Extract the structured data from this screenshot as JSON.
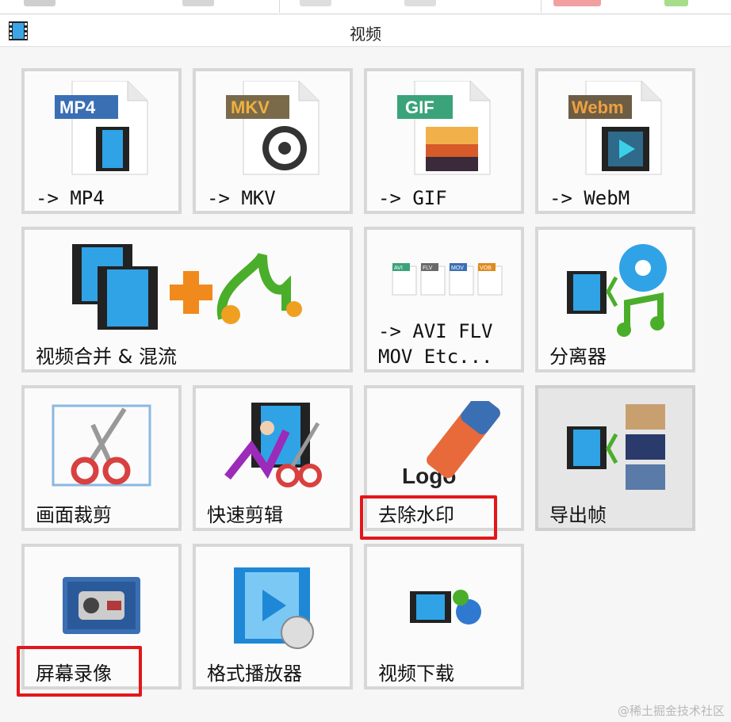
{
  "window": {
    "title": "视频"
  },
  "tiles": [
    {
      "label": "-> MP4",
      "badge": "MP4",
      "badge_color": "#3a6fb4"
    },
    {
      "label": "-> MKV",
      "badge": "MKV",
      "badge_color": "#7a6a4a"
    },
    {
      "label": "-> GIF",
      "badge": "GIF",
      "badge_color": "#3aa37a"
    },
    {
      "label": "-> WebM",
      "badge": "Webm",
      "badge_color": "#6d5d45"
    },
    {
      "label": "视频合并 & 混流"
    },
    {
      "label": "-> AVI FLV\nMOV Etc...",
      "format_badges": [
        "AVI",
        "FLV",
        "MOV",
        "VOB"
      ]
    },
    {
      "label": "分离器"
    },
    {
      "label": "画面裁剪"
    },
    {
      "label": "快速剪辑"
    },
    {
      "label": "去除水印",
      "logo_text": "Logo"
    },
    {
      "label": "导出帧"
    },
    {
      "label": "屏幕录像"
    },
    {
      "label": "格式播放器"
    },
    {
      "label": "视频下载"
    }
  ],
  "watermark": "@稀土掘金技术社区",
  "colors": {
    "highlight": "#e3161b",
    "film_blue": "#2fa3e6"
  }
}
